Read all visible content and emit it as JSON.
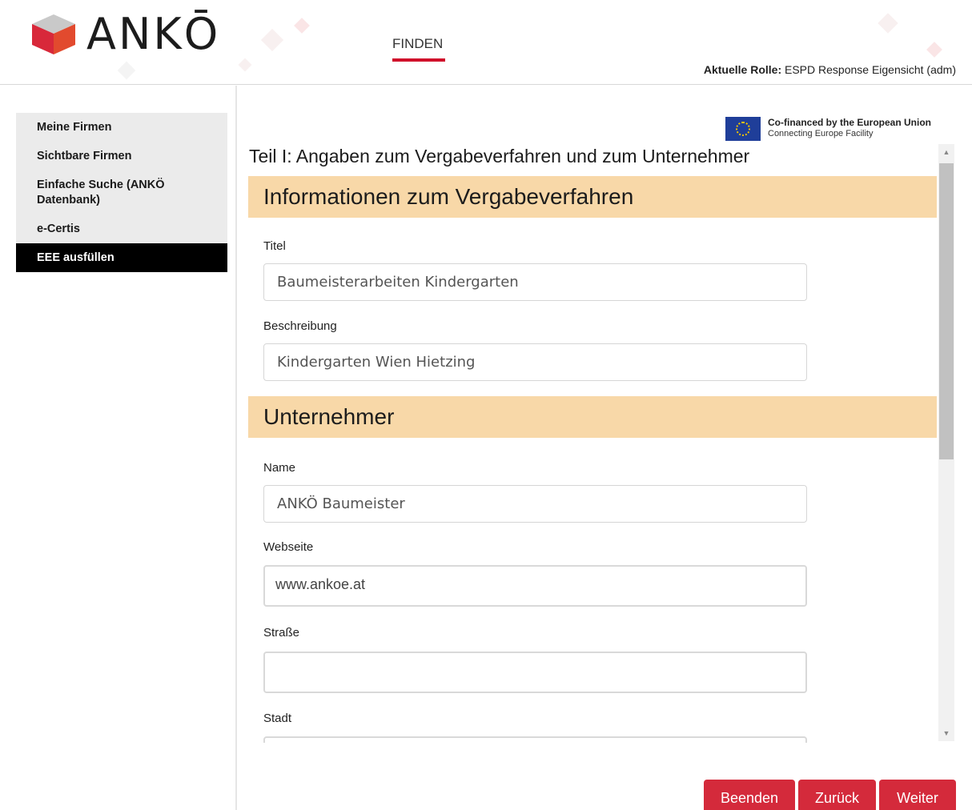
{
  "header": {
    "logo_text": "ANKŌ",
    "nav_finden": "FINDEN",
    "role_label": "Aktuelle Rolle:",
    "role_value": "ESPD Response Eigensicht (adm)"
  },
  "sidebar": {
    "items": [
      {
        "label": "Meine Firmen"
      },
      {
        "label": "Sichtbare Firmen"
      },
      {
        "label": "Einfache Suche (ANKÖ Datenbank)"
      },
      {
        "label": "e-Certis"
      },
      {
        "label": "EEE ausfüllen"
      }
    ]
  },
  "eu": {
    "line1": "Co-financed by the European Union",
    "line2": "Connecting Europe Facility"
  },
  "main": {
    "page_title": "Teil I: Angaben zum Vergabeverfahren und zum Unternehmer",
    "section1_title": "Informationen zum Vergabeverfahren",
    "titel_label": "Titel",
    "titel_value": "Baumeisterarbeiten Kindergarten",
    "beschreibung_label": "Beschreibung",
    "beschreibung_value": "Kindergarten Wien Hietzing",
    "section2_title": "Unternehmer",
    "name_label": "Name",
    "name_value": "ANKÖ Baumeister",
    "webseite_label": "Webseite",
    "webseite_value": "www.ankoe.at",
    "strasse_label": "Straße",
    "strasse_value": "",
    "stadt_label": "Stadt",
    "stadt_value": ""
  },
  "buttons": {
    "beenden": "Beenden",
    "zurueck": "Zurück",
    "weiter": "Weiter"
  },
  "colors": {
    "accent": "#d42a3b",
    "section_bg": "#f8d8a8",
    "active_nav": "#000000"
  }
}
